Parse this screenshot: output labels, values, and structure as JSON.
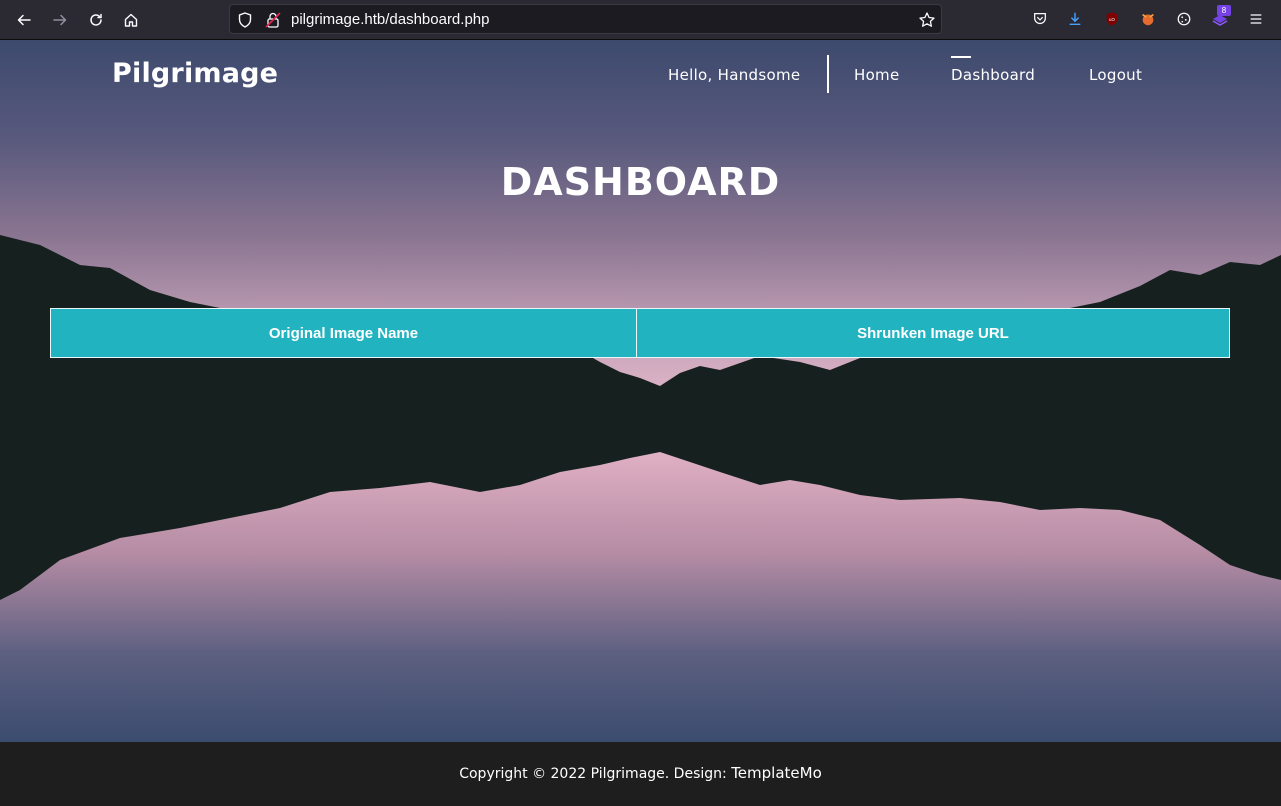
{
  "browser": {
    "url": "pilgrimage.htb/dashboard.php",
    "extension_badge": "8"
  },
  "site": {
    "brand": "Pilgrimage",
    "greeting": "Hello, Handsome",
    "nav": {
      "home": "Home",
      "dashboard": "Dashboard",
      "logout": "Logout"
    }
  },
  "main": {
    "title": "DASHBOARD",
    "table": {
      "headers": [
        "Original Image Name",
        "Shrunken Image URL"
      ],
      "rows": []
    }
  },
  "footer": {
    "copyright": "Copyright © 2022 Pilgrimage. Design: ",
    "design_link": "TemplateMo"
  }
}
